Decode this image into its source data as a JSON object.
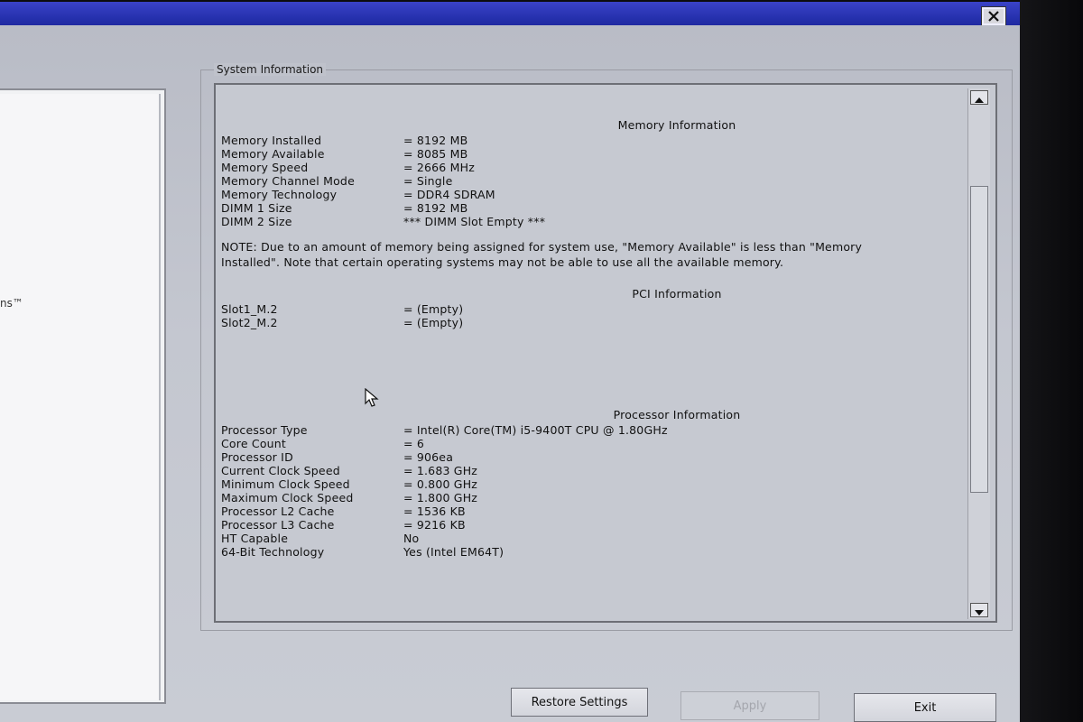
{
  "window": {
    "close_icon": "close-icon",
    "titlebar_color": "#2a33b4"
  },
  "nav": {
    "partial_text": "ns™"
  },
  "sysinfo": {
    "legend": "System Information",
    "memory": {
      "title": "Memory Information",
      "rows": [
        {
          "label": "Memory Installed",
          "value": "= 8192 MB"
        },
        {
          "label": "Memory Available",
          "value": "= 8085 MB"
        },
        {
          "label": "Memory Speed",
          "value": "= 2666 MHz"
        },
        {
          "label": "Memory Channel Mode",
          "value": "= Single"
        },
        {
          "label": "Memory Technology",
          "value": "= DDR4 SDRAM"
        },
        {
          "label": "DIMM 1 Size",
          "value": "= 8192 MB"
        },
        {
          "label": "DIMM 2 Size",
          "value": "*** DIMM Slot Empty ***"
        }
      ],
      "note": "NOTE: Due to an amount of memory being assigned for system use, \"Memory Available\" is less than \"Memory Installed\". Note that certain operating systems may not be able to use all the available memory."
    },
    "pci": {
      "title": "PCI Information",
      "rows": [
        {
          "label": "Slot1_M.2",
          "value": "= (Empty)"
        },
        {
          "label": "Slot2_M.2",
          "value": "= (Empty)"
        }
      ]
    },
    "processor": {
      "title": "Processor Information",
      "rows": [
        {
          "label": "Processor Type",
          "value": "= Intel(R) Core(TM) i5-9400T CPU @ 1.80GHz"
        },
        {
          "label": "Core Count",
          "value": "= 6"
        },
        {
          "label": "Processor ID",
          "value": "= 906ea"
        },
        {
          "label": "Current Clock Speed",
          "value": "= 1.683 GHz"
        },
        {
          "label": "Minimum Clock Speed",
          "value": "= 0.800 GHz"
        },
        {
          "label": "Maximum Clock Speed",
          "value": "= 1.800 GHz"
        },
        {
          "label": "Processor L2 Cache",
          "value": "= 1536 KB"
        },
        {
          "label": "Processor L3 Cache",
          "value": "= 9216 KB"
        },
        {
          "label": "HT Capable",
          "value": "No"
        },
        {
          "label": "64-Bit Technology",
          "value": "Yes (Intel EM64T)"
        }
      ]
    }
  },
  "buttons": {
    "restore_label": "Restore Settings",
    "apply_label": "Apply",
    "exit_label": "Exit"
  }
}
